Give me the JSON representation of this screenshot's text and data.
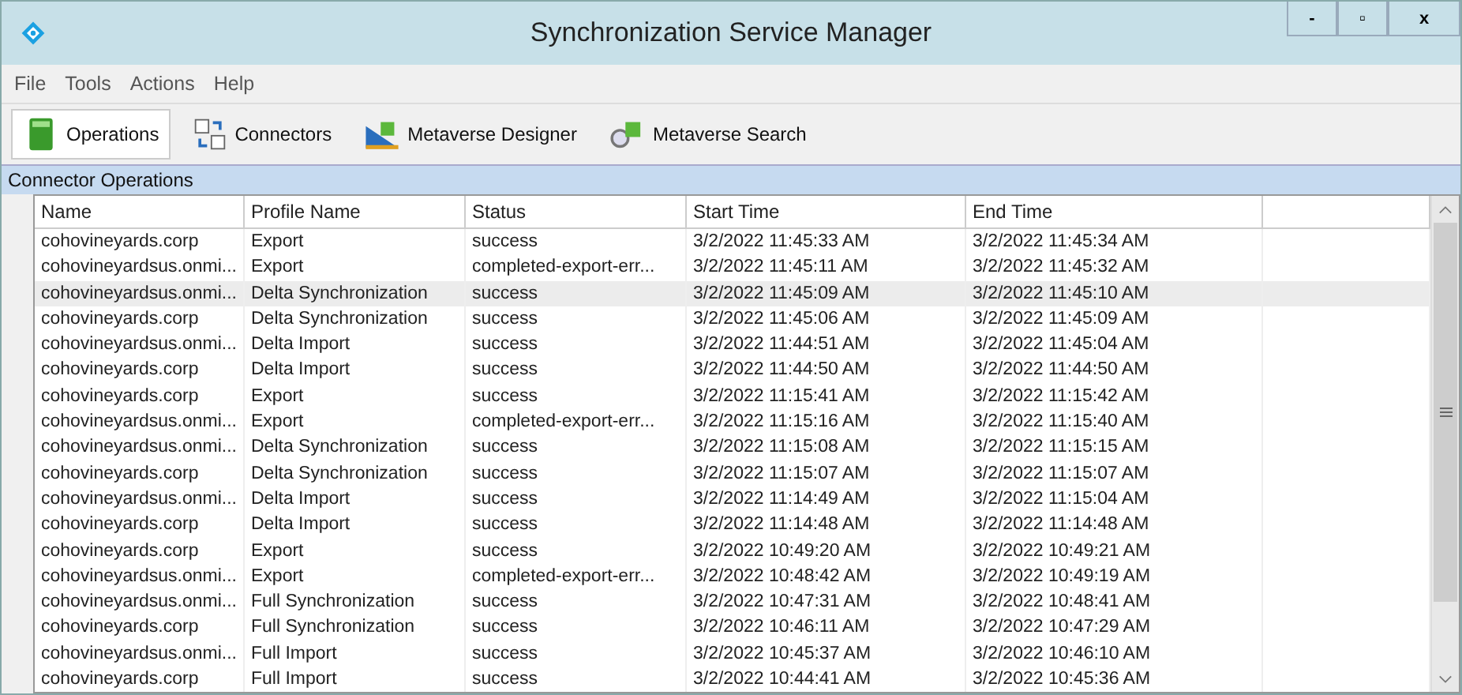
{
  "window": {
    "title": "Synchronization Service Manager",
    "controls": [
      "-",
      "▫",
      "x"
    ]
  },
  "menu": [
    "File",
    "Tools",
    "Actions",
    "Help"
  ],
  "toolbar": [
    {
      "label": "Operations",
      "selected": true,
      "kind": "operations"
    },
    {
      "label": "Connectors",
      "selected": false,
      "kind": "connectors"
    },
    {
      "label": "Metaverse Designer",
      "selected": false,
      "kind": "designer"
    },
    {
      "label": "Metaverse Search",
      "selected": false,
      "kind": "search"
    }
  ],
  "section_title": "Connector Operations",
  "table": {
    "columns": [
      "Name",
      "Profile Name",
      "Status",
      "Start Time",
      "End Time"
    ],
    "rows": [
      {
        "cells": [
          "cohovineyards.corp",
          "Export",
          "success",
          "3/2/2022 11:45:33 AM",
          "3/2/2022 11:45:34 AM"
        ],
        "selected": false
      },
      {
        "cells": [
          "cohovineyardsus.onmi...",
          "Export",
          "completed-export-err...",
          "3/2/2022 11:45:11 AM",
          "3/2/2022 11:45:32 AM"
        ],
        "selected": false
      },
      {
        "cells": [
          "cohovineyardsus.onmi...",
          "Delta Synchronization",
          "success",
          "3/2/2022 11:45:09 AM",
          "3/2/2022 11:45:10 AM"
        ],
        "selected": true
      },
      {
        "cells": [
          "cohovineyards.corp",
          "Delta Synchronization",
          "success",
          "3/2/2022 11:45:06 AM",
          "3/2/2022 11:45:09 AM"
        ],
        "selected": false
      },
      {
        "cells": [
          "cohovineyardsus.onmi...",
          "Delta Import",
          "success",
          "3/2/2022 11:44:51 AM",
          "3/2/2022 11:45:04 AM"
        ],
        "selected": false
      },
      {
        "cells": [
          "cohovineyards.corp",
          "Delta Import",
          "success",
          "3/2/2022 11:44:50 AM",
          "3/2/2022 11:44:50 AM"
        ],
        "selected": false
      },
      {
        "cells": [
          "cohovineyards.corp",
          "Export",
          "success",
          "3/2/2022 11:15:41 AM",
          "3/2/2022 11:15:42 AM"
        ],
        "selected": false
      },
      {
        "cells": [
          "cohovineyardsus.onmi...",
          "Export",
          "completed-export-err...",
          "3/2/2022 11:15:16 AM",
          "3/2/2022 11:15:40 AM"
        ],
        "selected": false
      },
      {
        "cells": [
          "cohovineyardsus.onmi...",
          "Delta Synchronization",
          "success",
          "3/2/2022 11:15:08 AM",
          "3/2/2022 11:15:15 AM"
        ],
        "selected": false
      },
      {
        "cells": [
          "cohovineyards.corp",
          "Delta Synchronization",
          "success",
          "3/2/2022 11:15:07 AM",
          "3/2/2022 11:15:07 AM"
        ],
        "selected": false
      },
      {
        "cells": [
          "cohovineyardsus.onmi...",
          "Delta Import",
          "success",
          "3/2/2022 11:14:49 AM",
          "3/2/2022 11:15:04 AM"
        ],
        "selected": false
      },
      {
        "cells": [
          "cohovineyards.corp",
          "Delta Import",
          "success",
          "3/2/2022 11:14:48 AM",
          "3/2/2022 11:14:48 AM"
        ],
        "selected": false
      },
      {
        "cells": [
          "cohovineyards.corp",
          "Export",
          "success",
          "3/2/2022 10:49:20 AM",
          "3/2/2022 10:49:21 AM"
        ],
        "selected": false
      },
      {
        "cells": [
          "cohovineyardsus.onmi...",
          "Export",
          "completed-export-err...",
          "3/2/2022 10:48:42 AM",
          "3/2/2022 10:49:19 AM"
        ],
        "selected": false
      },
      {
        "cells": [
          "cohovineyardsus.onmi...",
          "Full Synchronization",
          "success",
          "3/2/2022 10:47:31 AM",
          "3/2/2022 10:48:41 AM"
        ],
        "selected": false
      },
      {
        "cells": [
          "cohovineyards.corp",
          "Full Synchronization",
          "success",
          "3/2/2022 10:46:11 AM",
          "3/2/2022 10:47:29 AM"
        ],
        "selected": false
      },
      {
        "cells": [
          "cohovineyardsus.onmi...",
          "Full Import",
          "success",
          "3/2/2022 10:45:37 AM",
          "3/2/2022 10:46:10 AM"
        ],
        "selected": false
      },
      {
        "cells": [
          "cohovineyards.corp",
          "Full Import",
          "success",
          "3/2/2022 10:44:41 AM",
          "3/2/2022 10:45:36 AM"
        ],
        "selected": false
      }
    ]
  }
}
